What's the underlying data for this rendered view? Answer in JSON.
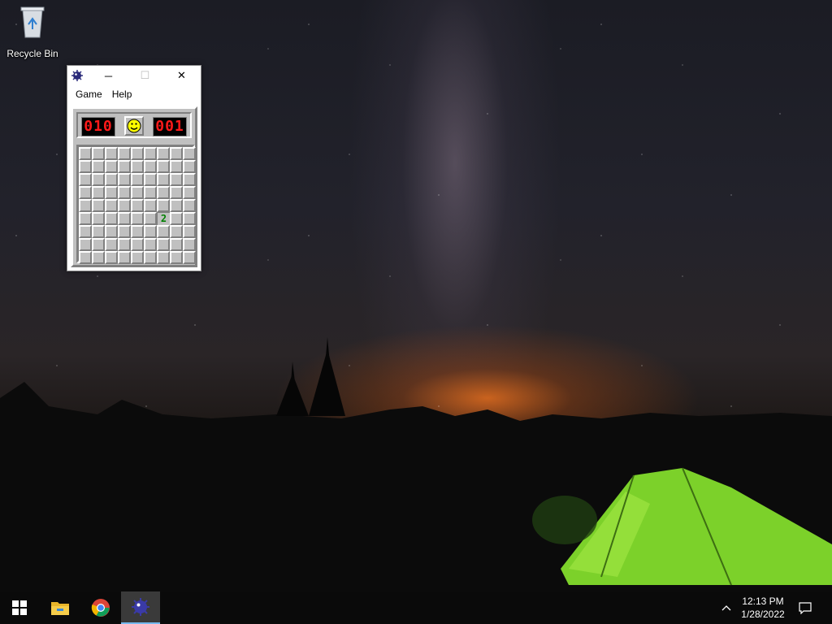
{
  "desktop": {
    "icons": [
      {
        "label": "Recycle Bin",
        "icon": "recycle-bin-icon"
      }
    ]
  },
  "window": {
    "app_icon": "minesweeper-icon",
    "controls": {
      "minimize": "─",
      "maximize": "☐",
      "close": "✕"
    },
    "menu": [
      "Game",
      "Help"
    ],
    "mine_counter": "010",
    "timer": "001",
    "smiley": "smiley-face-icon",
    "board": {
      "rows": 9,
      "cols": 9,
      "revealed": [
        {
          "row": 5,
          "col": 6,
          "value": "2"
        }
      ],
      "number_color": "#008000"
    }
  },
  "taskbar": {
    "items": [
      "start-button",
      "file-explorer-icon",
      "chrome-icon",
      "minesweeper-icon"
    ],
    "active_item": "minesweeper-icon",
    "time": "12:13 PM",
    "date": "1/28/2022"
  },
  "colors": {
    "window_bg": "#c0c0c0",
    "lcd_bg": "#000000",
    "lcd_fg": "#ff1a1a",
    "taskbar_bg": "#0a0a0a",
    "taskbar_accent": "#76b9ed"
  }
}
